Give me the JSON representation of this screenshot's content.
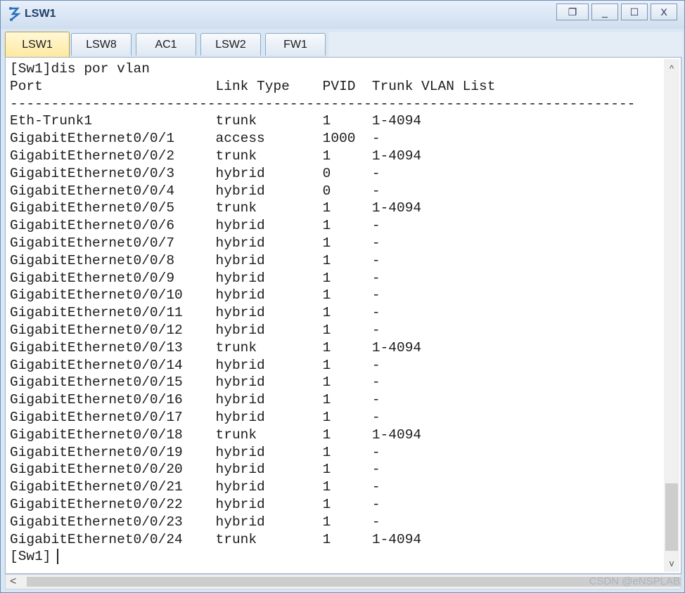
{
  "window": {
    "title": "LSW1"
  },
  "controls": {
    "restore_symbol": "❐",
    "minimize_symbol": "_",
    "maximize_symbol": "☐",
    "close_symbol": "X"
  },
  "tabs": [
    {
      "label": "LSW1",
      "active": true
    },
    {
      "label": "LSW8",
      "active": false
    },
    {
      "label": "AC1",
      "active": false
    },
    {
      "label": "LSW2",
      "active": false
    },
    {
      "label": "FW1",
      "active": false
    }
  ],
  "console": {
    "lines": [
      "[Sw1]dis por vlan",
      "Port                     Link Type    PVID  Trunk VLAN List",
      "----------------------------------------------------------------------------",
      "Eth-Trunk1               trunk        1     1-4094",
      "GigabitEthernet0/0/1     access       1000  -",
      "GigabitEthernet0/0/2     trunk        1     1-4094",
      "GigabitEthernet0/0/3     hybrid       0     -",
      "GigabitEthernet0/0/4     hybrid       0     -",
      "GigabitEthernet0/0/5     trunk        1     1-4094",
      "GigabitEthernet0/0/6     hybrid       1     -",
      "GigabitEthernet0/0/7     hybrid       1     -",
      "GigabitEthernet0/0/8     hybrid       1     -",
      "GigabitEthernet0/0/9     hybrid       1     -",
      "GigabitEthernet0/0/10    hybrid       1     -",
      "GigabitEthernet0/0/11    hybrid       1     -",
      "GigabitEthernet0/0/12    hybrid       1     -",
      "GigabitEthernet0/0/13    trunk        1     1-4094",
      "GigabitEthernet0/0/14    hybrid       1     -",
      "GigabitEthernet0/0/15    hybrid       1     -",
      "GigabitEthernet0/0/16    hybrid       1     -",
      "GigabitEthernet0/0/17    hybrid       1     -",
      "GigabitEthernet0/0/18    trunk        1     1-4094",
      "GigabitEthernet0/0/19    hybrid       1     -",
      "GigabitEthernet0/0/20    hybrid       1     -",
      "GigabitEthernet0/0/21    hybrid       1     -",
      "GigabitEthernet0/0/22    hybrid       1     -",
      "GigabitEthernet0/0/23    hybrid       1     -",
      "GigabitEthernet0/0/24    trunk        1     1-4094"
    ],
    "prompt": "[Sw1]"
  },
  "scroll": {
    "up_arrow": "^",
    "down_arrow": "v",
    "left_arrow": "<"
  },
  "watermark": "CSDN @eNSPLAB"
}
